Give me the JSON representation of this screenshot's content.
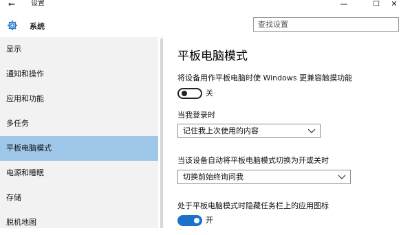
{
  "window": {
    "title": "设置",
    "back_glyph": "←",
    "minimize_glyph": "—",
    "maximize_glyph": "☐",
    "close_glyph": "✕"
  },
  "header": {
    "title": "系统",
    "icon": "gear-icon",
    "search_placeholder": "查找设置"
  },
  "sidebar": {
    "items": [
      {
        "label": "显示"
      },
      {
        "label": "通知和操作"
      },
      {
        "label": "应用和功能"
      },
      {
        "label": "多任务"
      },
      {
        "label": "平板电脑模式",
        "active": true
      },
      {
        "label": "电源和睡眠"
      },
      {
        "label": "存储"
      },
      {
        "label": "脱机地图"
      }
    ]
  },
  "content": {
    "title": "平板电脑模式",
    "setting1": {
      "label": "将设备用作平板电脑时使 Windows 更兼容触摸功能",
      "toggle_state": "off",
      "toggle_text": "关"
    },
    "setting2": {
      "label": "当我登录时",
      "value": "记住我上次使用的内容"
    },
    "setting3": {
      "label": "当该设备自动将平板电脑模式切换为开或关时",
      "value": "切换前始终询问我"
    },
    "setting4": {
      "label": "处于平板电脑模式时隐藏任务栏上的应用图标",
      "toggle_state": "on",
      "toggle_text": "开"
    }
  },
  "colors": {
    "accent": "#1a73c8",
    "sidebar_bg": "#f2f2f2",
    "sidebar_active": "#9ec7ea"
  }
}
